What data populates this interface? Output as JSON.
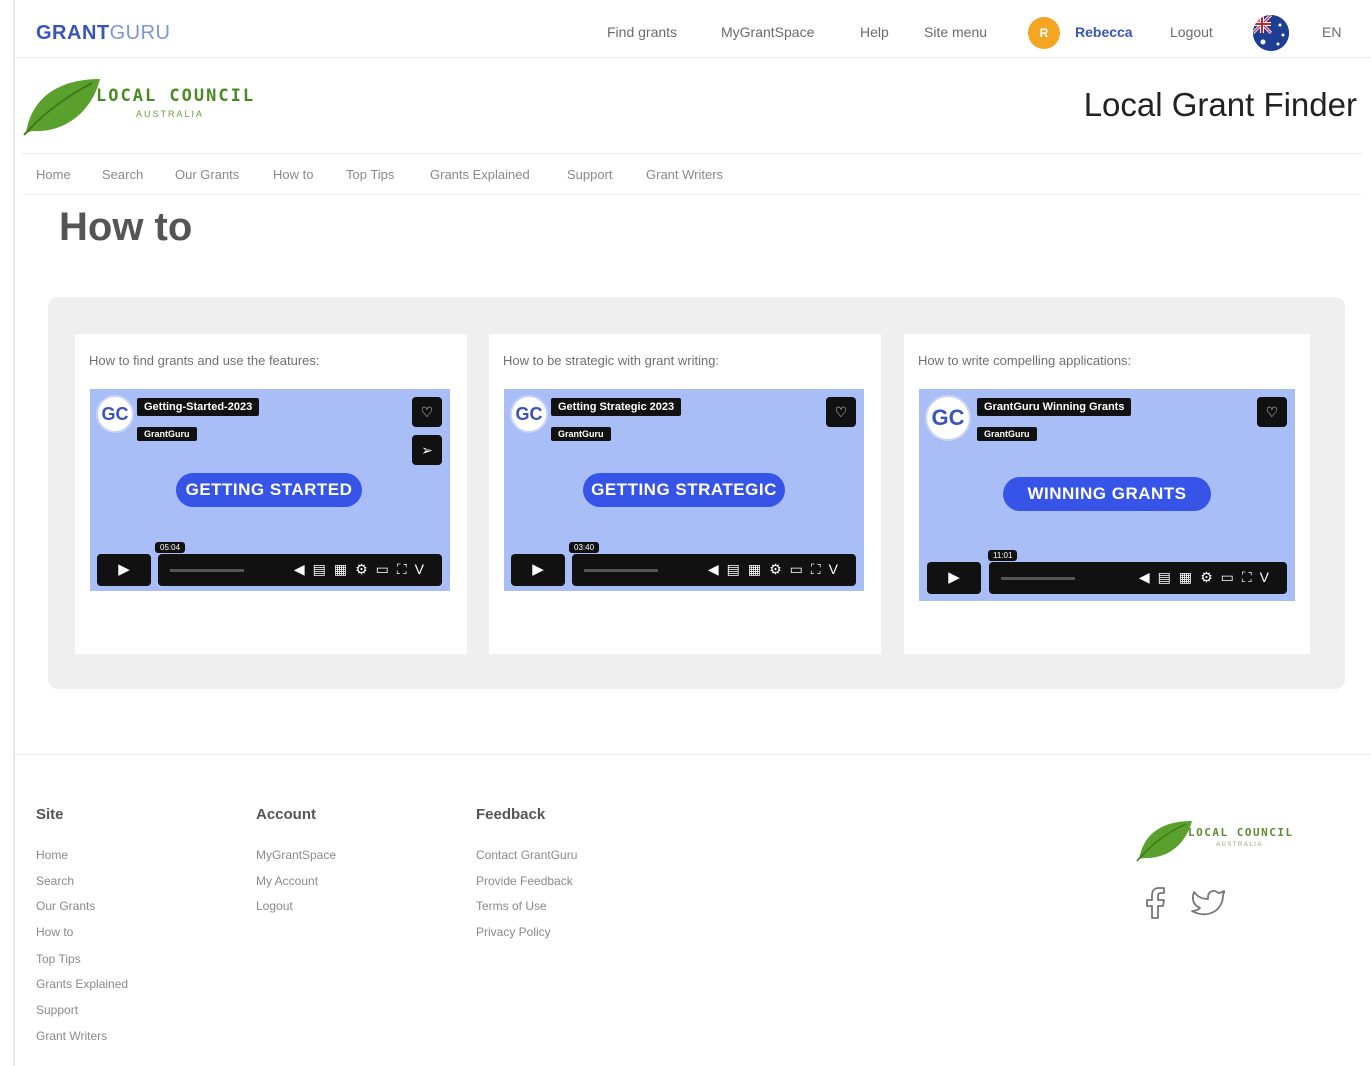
{
  "header": {
    "brand_part1": "GRANT",
    "brand_part2": "GURU",
    "nav": [
      "Find grants",
      "MyGrantSpace",
      "Help",
      "Site menu"
    ],
    "avatar_initial": "R",
    "user_name": "Rebecca",
    "logout": "Logout",
    "language": "EN",
    "flag_icon": "australia-flag-icon"
  },
  "council": {
    "logo_title": "LOCAL COUNCIL",
    "logo_subtitle": "AUSTRALIA",
    "site_title": "Local Grant Finder",
    "menu": [
      "Home",
      "Search",
      "Our Grants",
      "How to",
      "Top Tips",
      "Grants Explained",
      "Support",
      "Grant Writers"
    ]
  },
  "page": {
    "title": "How to"
  },
  "videos": [
    {
      "caption": "How to find grants and use the features:",
      "video_title": "Getting-Started-2023",
      "channel": "GrantGuru",
      "banner": "GETTING STARTED",
      "time": "05:04"
    },
    {
      "caption": "How to be strategic with grant writing:",
      "video_title": "Getting Strategic 2023",
      "channel": "GrantGuru",
      "banner": "GETTING STRATEGIC",
      "time": "03:40"
    },
    {
      "caption": "How to write compelling applications:",
      "video_title": "GrantGuru Winning Grants",
      "channel": "GrantGuru",
      "banner": "WINNING GRANTS",
      "time": "11:01"
    }
  ],
  "footer": {
    "site_heading": "Site",
    "site_links": [
      "Home",
      "Search",
      "Our Grants",
      "How to",
      "Top Tips",
      "Grants Explained",
      "Support",
      "Grant Writers"
    ],
    "account_heading": "Account",
    "account_links": [
      "MyGrantSpace",
      "My Account",
      "Logout"
    ],
    "feedback_heading": "Feedback",
    "feedback_links": [
      "Contact GrantGuru",
      "Provide Feedback",
      "Terms of Use",
      "Privacy Policy"
    ],
    "logo_title": "LOCAL COUNCIL",
    "logo_subtitle": "AUSTRALIA",
    "social_icons": [
      "facebook-icon",
      "twitter-icon"
    ]
  },
  "colors": {
    "brand_blue": "#3a55b6",
    "avatar_orange": "#f3a623",
    "leaf_green": "#5aa02c",
    "video_bg": "#a9bdf7",
    "banner_blue": "#3654e8"
  }
}
